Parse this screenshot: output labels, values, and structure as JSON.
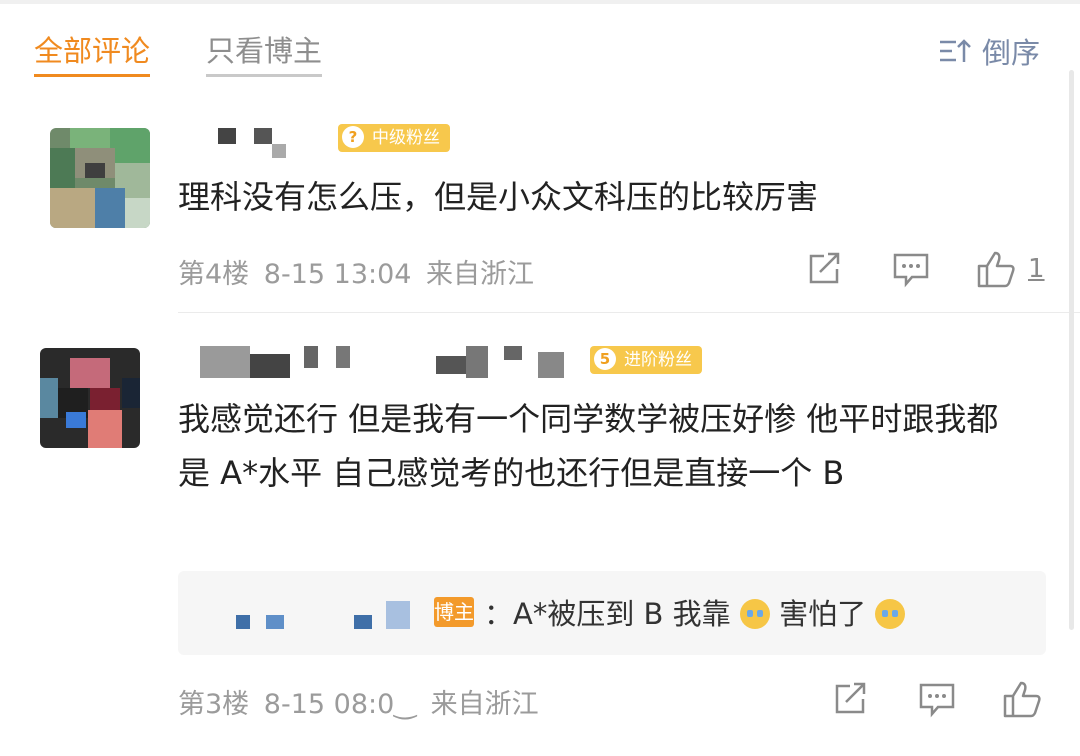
{
  "tabs": {
    "all": "全部评论",
    "author_only": "只看博主"
  },
  "sort": {
    "label": "倒序"
  },
  "comments": [
    {
      "badge": {
        "level": "?",
        "label": "中级粉丝"
      },
      "text": "理科没有怎么压，但是小众文科压的比较厉害",
      "floor": "第4楼",
      "time": "8-15 13:04",
      "location": "来自浙江",
      "likes": "1"
    },
    {
      "badge": {
        "level": "5",
        "label": "进阶粉丝"
      },
      "text": "我感觉还行 但是我有一个同学数学被压好惨 他平时跟我都是 A*水平 自己感觉考的也还行但是直接一个 B",
      "reply": {
        "author_tag": "博主",
        "text_a": "：A*被压到 B 我靠",
        "text_b": "害怕了"
      },
      "floor": "第3楼",
      "time": "8-15 08:0‿",
      "location": "来自浙江"
    }
  ],
  "colors": {
    "accent": "#f08a1f",
    "badge": "#f7c84c",
    "sort": "#7a8aa8"
  }
}
